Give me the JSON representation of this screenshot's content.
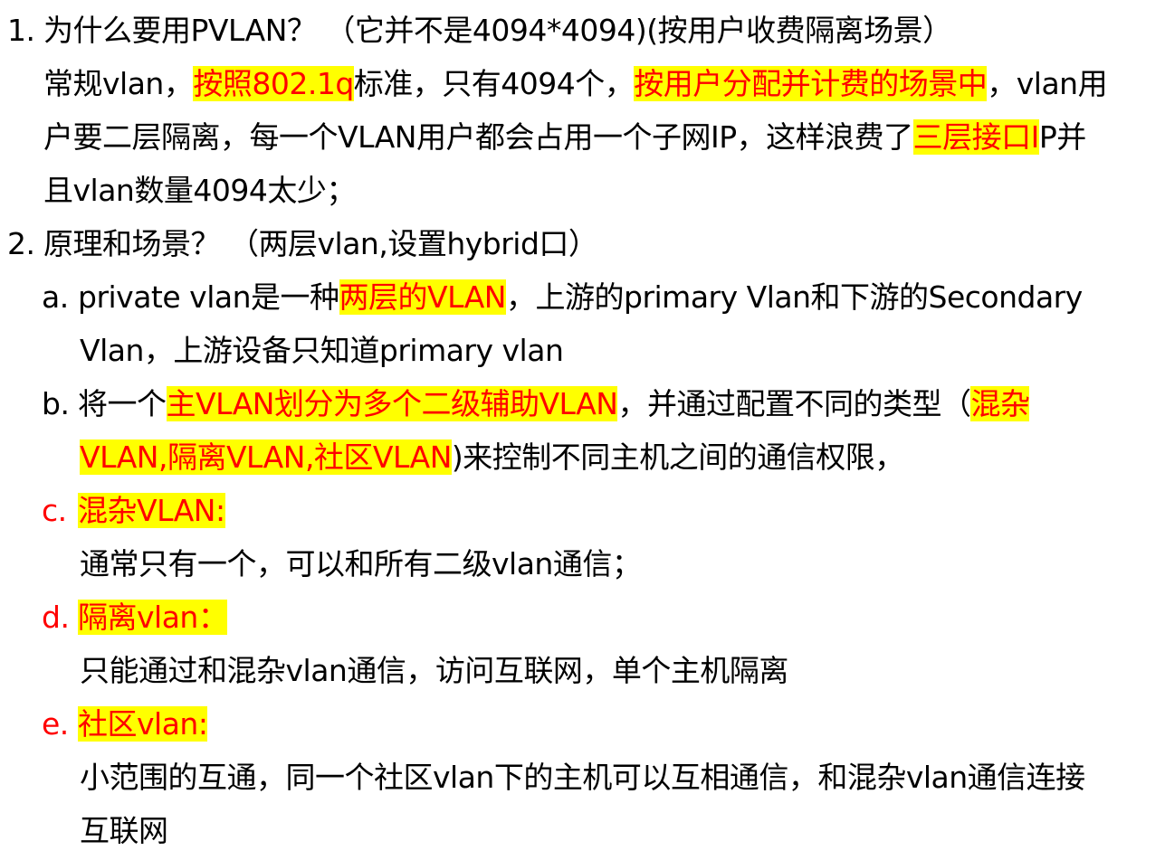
{
  "item1": {
    "number": "1.",
    "title": "为什么要用PVLAN？ （它并不是4094*4094)(按用户收费隔离场景）",
    "line1_a": "常规vlan，",
    "line1_hl1": "按照802.1q",
    "line1_b": "标准，只有4094个，",
    "line1_hl2": "按用户分配并计费的场景中",
    "line1_c": "，vlan用",
    "line2_a": "户要二层隔离，每一个VLAN用户都会占用一个子网IP，这样浪费了",
    "line2_hl": "三层接口I",
    "line2_b": "P并",
    "line3": "且vlan数量4094太少；"
  },
  "item2": {
    "number": "2.",
    "title": "原理和场景？ （两层vlan,设置hybrid口）",
    "a": {
      "marker": "a.",
      "l1_a": "private vlan是一种",
      "l1_hl": "两层的VLAN",
      "l1_b": "，上游的primary Vlan和下游的Secondary",
      "l2": "Vlan，上游设备只知道primary vlan"
    },
    "b": {
      "marker": "b.",
      "l1_a": "将一个",
      "l1_hl1": "主VLAN划分为多个二级辅助VLAN",
      "l1_b": "，并通过配置不同的类型（",
      "l1_hl2": "混杂",
      "l2_hl": "VLAN,隔离VLAN,社区VLAN",
      "l2_b": ")来控制不同主机之间的通信权限，"
    },
    "c": {
      "marker": "c.",
      "heading": "混杂VLAN:",
      "body": "通常只有一个，可以和所有二级vlan通信；"
    },
    "d": {
      "marker": "d.",
      "heading": "隔离vlan：",
      "body": "只能通过和混杂vlan通信，访问互联网，单个主机隔离"
    },
    "e": {
      "marker": "e.",
      "heading": "社区vlan:",
      "body_l1": "小范围的互通，同一个社区vlan下的主机可以互相通信，和混杂vlan通信连接",
      "body_l2": "互联网"
    }
  },
  "colors": {
    "highlight_background": "#ffff00",
    "highlight_text": "#ff0000",
    "text": "#000000"
  }
}
